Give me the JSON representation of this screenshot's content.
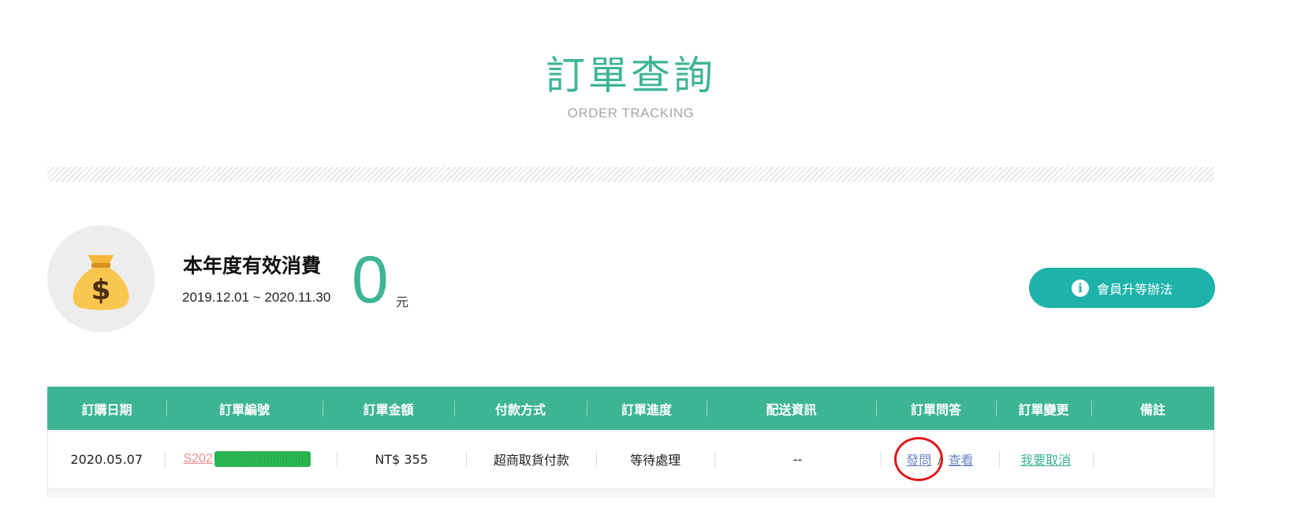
{
  "header": {
    "title": "訂單查詢",
    "subtitle": "ORDER TRACKING"
  },
  "spending": {
    "icon": "money-bag-icon",
    "label": "本年度有效消費",
    "period": "2019.12.01 ~ 2020.11.30",
    "amount": "0",
    "unit": "元"
  },
  "upgrade_button": {
    "icon": "info-icon",
    "label": "會員升等辦法"
  },
  "table": {
    "headers": [
      "訂購日期",
      "訂單編號",
      "訂單金額",
      "付款方式",
      "訂單進度",
      "配送資訊",
      "訂單問答",
      "訂單變更",
      "備註"
    ],
    "rows": [
      {
        "date": "2020.05.07",
        "order_no": "S202",
        "amount": "NT$ 355",
        "payment": "超商取貨付款",
        "status": "等待處理",
        "shipping": "--",
        "qa_ask": "發問",
        "qa_sep": "/",
        "qa_view": "查看",
        "change": "我要取消",
        "note": ""
      }
    ]
  },
  "colors": {
    "accent": "#3db595",
    "button": "#1db2aa",
    "annotation": "#e0161c"
  }
}
